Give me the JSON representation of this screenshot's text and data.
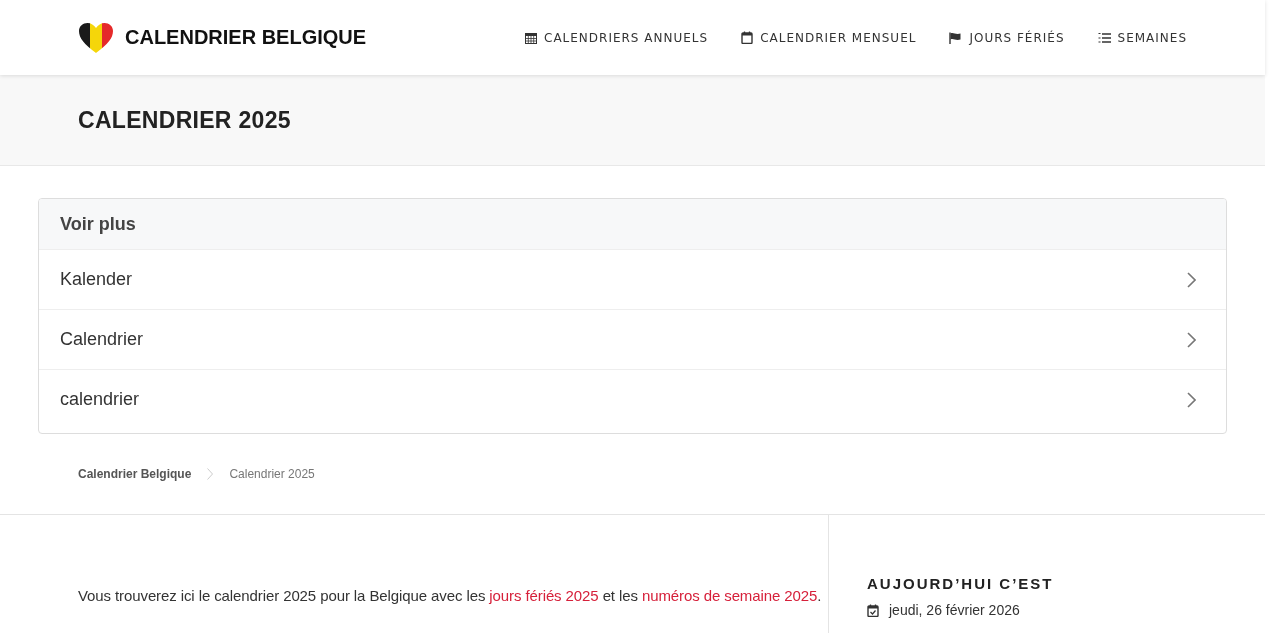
{
  "header": {
    "site_title": "CALENDRIER BELGIQUE",
    "nav": [
      {
        "kind": "calendar-grid",
        "label": "CALENDRIERS ANNUELS"
      },
      {
        "kind": "calendar",
        "label": "CALENDRIER MENSUEL"
      },
      {
        "kind": "flag",
        "label": "JOURS FÉRIÉS"
      },
      {
        "kind": "list",
        "label": "SEMAINES"
      }
    ]
  },
  "page_title": "CALENDRIER 2025",
  "see_more": {
    "heading": "Voir plus",
    "items": [
      "Kalender",
      "Calendrier",
      "calendrier"
    ]
  },
  "breadcrumb": [
    "Calendrier Belgique",
    "Calendrier 2025"
  ],
  "intro": {
    "parts": [
      {
        "kind": "text",
        "text": "Vous trouverez ici le calendrier 2025 pour la Belgique avec les "
      },
      {
        "kind": "link",
        "text": "jours fériés 2025"
      },
      {
        "kind": "text",
        "text": " et les "
      },
      {
        "kind": "link",
        "text": "numéros de semaine 2025"
      },
      {
        "kind": "text",
        "text": "."
      }
    ]
  },
  "sidebar": {
    "heading": "AUJOURD’HUI C’EST",
    "date": "jeudi, 26 février 2026"
  }
}
